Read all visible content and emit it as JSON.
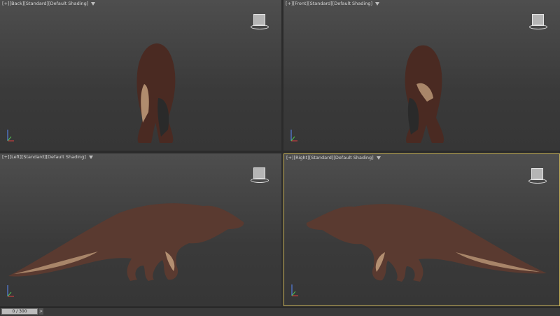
{
  "viewports": {
    "back": {
      "plus": "[+]",
      "view": "[Back]",
      "mode": "[Standard]",
      "shading": "[Default Shading]"
    },
    "front": {
      "plus": "[+]",
      "view": "[Front]",
      "mode": "[Standard]",
      "shading": "[Default Shading]"
    },
    "left": {
      "plus": "[+]",
      "view": "[Left]",
      "mode": "[Standard]",
      "shading": "[Default Shading]"
    },
    "right": {
      "plus": "[+]",
      "view": "[Right]",
      "mode": "[Standard]",
      "shading": "[Default Shading]"
    }
  },
  "timeline": {
    "frame": "0 / 300",
    "next": ">"
  },
  "colors": {
    "active_border": "#c8b25a",
    "viewport_bg": "#474747",
    "dino_skin": "#5a3a30",
    "dino_dark": "#222222"
  }
}
